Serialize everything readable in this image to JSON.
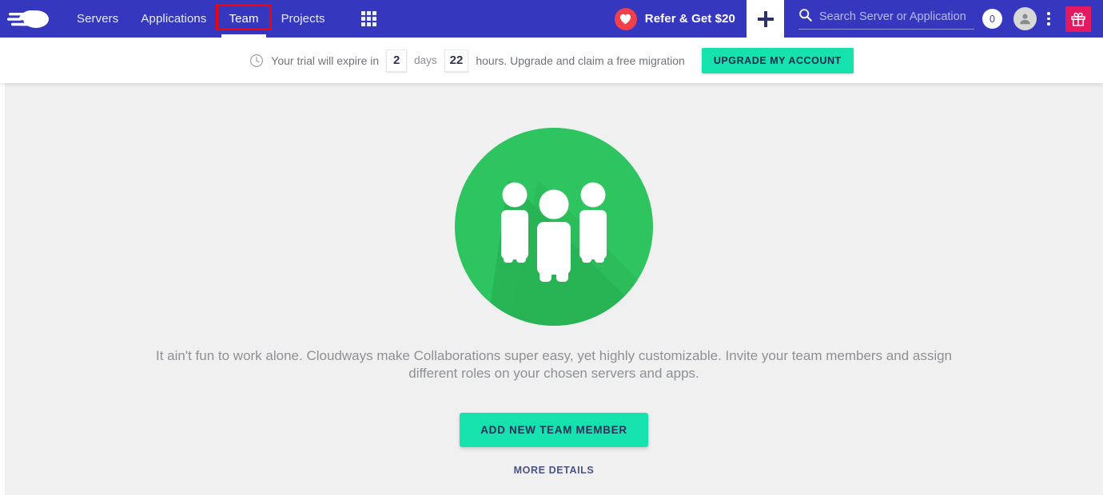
{
  "brand": {
    "logo_name": "cloudways-logo",
    "nav_bg": "#3538bf",
    "accent_green": "#16e2ad",
    "gift_bg": "#e5195f",
    "heart_bg": "#f1404b",
    "annotation_color": "#f70000",
    "illustration_green": "#2ec45f"
  },
  "nav": {
    "links": [
      {
        "label": "Servers",
        "active": false,
        "annotated": false
      },
      {
        "label": "Applications",
        "active": false,
        "annotated": false
      },
      {
        "label": "Team",
        "active": true,
        "annotated": true
      },
      {
        "label": "Projects",
        "active": false,
        "annotated": false
      }
    ],
    "apps_grid_label": "apps-grid",
    "refer_label": "Refer & Get $20",
    "add_label": "+",
    "search_placeholder": "Search Server or Application",
    "search_value": "",
    "search_count": "0",
    "kebab_label": "more-options",
    "gift_label": "gift"
  },
  "banner": {
    "lead_text": "Your trial will expire in",
    "days_value": "2",
    "days_unit": "days",
    "hours_value": "22",
    "tail_text": "hours. Upgrade and claim a free migration",
    "upgrade_label": "UPGRADE MY ACCOUNT"
  },
  "main": {
    "illustration_name": "team-people-illustration",
    "blurb": "It ain't fun to work alone. Cloudways make Collaborations super easy, yet highly customizable. Invite your team members and assign different roles on your chosen servers and apps.",
    "add_member_label": "ADD NEW TEAM MEMBER",
    "more_details_label": "MORE DETAILS"
  }
}
